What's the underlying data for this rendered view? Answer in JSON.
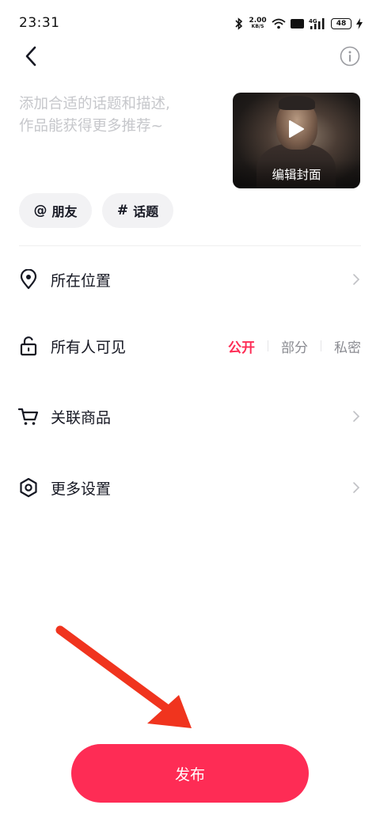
{
  "status_bar": {
    "time": "23:31",
    "net_speed_value": "2.00",
    "net_speed_unit": "KB/S",
    "hd_label": "HD",
    "signal_label": "4G",
    "battery": "48",
    "icons": [
      "bluetooth-icon",
      "wifi-icon",
      "hd-icon",
      "signal-icon",
      "battery-icon",
      "charging-icon"
    ]
  },
  "nav": {
    "back_icon": "chevron-left-icon",
    "info_icon": "info-icon"
  },
  "description": {
    "placeholder": "添加合适的话题和描述,\n作品能获得更多推荐~"
  },
  "cover": {
    "edit_label": "编辑封面",
    "play_icon": "play-icon"
  },
  "chips": {
    "mention": {
      "symbol": "@",
      "label": "朋友"
    },
    "topic": {
      "symbol": "#",
      "label": "话题"
    }
  },
  "settings": {
    "location": {
      "label": "所在位置",
      "icon": "location-pin-icon"
    },
    "visibility": {
      "label": "所有人可见",
      "icon": "unlock-icon",
      "options": [
        "公开",
        "部分",
        "私密"
      ],
      "selected": "公开"
    },
    "products": {
      "label": "关联商品",
      "icon": "cart-icon"
    },
    "more": {
      "label": "更多设置",
      "icon": "hexagon-settings-icon"
    }
  },
  "publish": {
    "label": "发布"
  },
  "colors": {
    "accent": "#fe2c55",
    "text_primary": "#161823",
    "text_secondary": "#8a8b91",
    "placeholder": "#c6c7cb",
    "chip_bg": "#f2f2f4",
    "annotation_arrow": "#f0341e"
  }
}
